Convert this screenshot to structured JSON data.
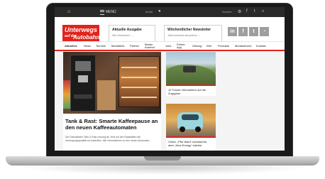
{
  "topbar": {
    "home_icon": "home-icon",
    "menu_label": "MENÜ",
    "mini_left": "Inhalt",
    "mini_right": "Suchen"
  },
  "header": {
    "logo_line1": "Unterwegs",
    "logo_line2": "auf der",
    "logo_line3": "Autobahn",
    "edition_title": "Aktuelle Ausgabe",
    "edition_link": "Hier informieren →",
    "newsletter_title": "Wöchentlicher Newsletter",
    "newsletter_link": "Jetzt kostenlos abonnieren →",
    "social": [
      "in",
      "f",
      "t",
      "rss"
    ]
  },
  "nav": {
    "items": [
      "Aktuelles",
      "News",
      "Termine",
      "Mediathek",
      "Partner",
      "Bester Autohof",
      "Jobs",
      "Fahrer App",
      "Zeitung",
      "Wer",
      "Produkte",
      "Mediaservice",
      "Kontakt"
    ]
  },
  "main_article": {
    "title": "Tank & Rast: Smarte Kaffeepause an den neuen Kaffeeautomaten",
    "teaser": "Der Dienstleister Tank & Rast versorgt ab Jetzt auf den Raststätten die Versorgungsqualität an Autohöfen. Alle Informationen zu den neuen Automaten."
  },
  "side_articles": [
    {
      "caption": "19 Tonnen Klimaretten auf die Zugspitze"
    },
    {
      "caption": "China: „Pfer-Wahl“ schwächelt, aber „New Energy“ wächst"
    }
  ],
  "colors": {
    "brand_red": "#e0241b",
    "bezel": "#1a1a1a"
  }
}
